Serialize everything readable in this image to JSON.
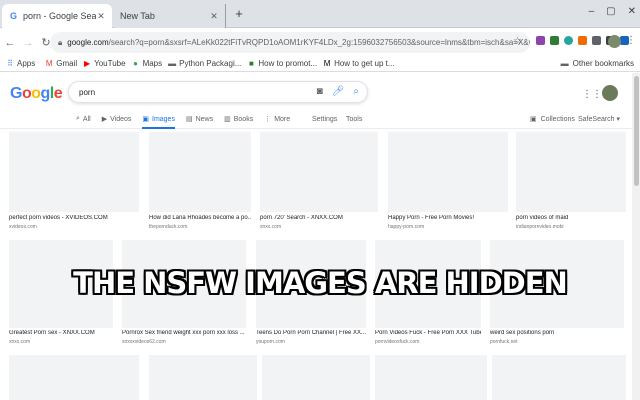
{
  "browser": {
    "tabs": [
      {
        "title": "porn - Google Search",
        "favicon": "G",
        "active": true
      },
      {
        "title": "New Tab",
        "active": false
      }
    ],
    "new_tab_symbol": "+",
    "window_controls": [
      "–",
      "▢",
      "✕"
    ],
    "url_host": "google.com",
    "url_rest": "/search?q=porn&sxsrf=ALeKk022tFiTvRQPD1oAOM1rKYF4LDx_2g:1596032756503&source=lnms&tbm=isch&sa=X&ved=2ahUKEwj43o...",
    "bookmarks": [
      {
        "label": "Apps",
        "icon": "apps-grid-icon",
        "color": "#4285f4"
      },
      {
        "label": "Gmail",
        "icon": "gmail-icon",
        "color": "#ea4335"
      },
      {
        "label": "YouTube",
        "icon": "youtube-icon",
        "color": "#ff0000"
      },
      {
        "label": "Maps",
        "icon": "maps-pin-icon",
        "color": "#34a853"
      },
      {
        "label": "Python Packagi...",
        "icon": "folder-icon",
        "color": "#5f6368"
      },
      {
        "label": "How to promot...",
        "icon": "bookmark-favicon-icon",
        "color": "#2e7d32"
      },
      {
        "label": "How to get up t...",
        "icon": "medium-icon",
        "color": "#000000"
      }
    ],
    "other_bookmarks": "Other bookmarks"
  },
  "google": {
    "logo": "Google",
    "logo_colors": [
      "#4285f4",
      "#ea4335",
      "#fbbc05",
      "#4285f4",
      "#34a853",
      "#ea4335"
    ],
    "query": "porn",
    "tabs": [
      {
        "label": "All",
        "icon": "search-icon",
        "active": false
      },
      {
        "label": "Videos",
        "icon": "video-icon",
        "active": false
      },
      {
        "label": "Images",
        "icon": "image-icon",
        "active": true
      },
      {
        "label": "News",
        "icon": "news-icon",
        "active": false
      },
      {
        "label": "Books",
        "icon": "book-icon",
        "active": false
      },
      {
        "label": "More",
        "icon": "more-dots-icon",
        "active": false
      }
    ],
    "settings": "Settings",
    "tools": "Tools",
    "collections": "Collections",
    "safesearch": "SafeSearch ▾"
  },
  "results": [
    {
      "caption": "perfect porn videos - XVIDEOS.COM",
      "source": "xvideos.com"
    },
    {
      "caption": "How did Lana Rhoades become a po...",
      "source": "thepornduck.com"
    },
    {
      "caption": "porn 720' Search - XNXX.COM",
      "source": "xnxx.com"
    },
    {
      "caption": "Happy Porn - Free Porn Movies!",
      "source": "happy-porn.com"
    },
    {
      "caption": "porn videos of maid",
      "source": "indianpornvideo.mobi"
    },
    {
      "caption": "Greatest Porn sex - XNXX.COM",
      "source": "xnxx.com"
    },
    {
      "caption": "Pornrox Sex friend weight xxx porn xxx loss ...",
      "source": "xnxxxvideos62.com"
    },
    {
      "caption": "Teens Do Porn Porn Channel | Free XX...",
      "source": "youporn.com"
    },
    {
      "caption": "Porn Videos Fuck - Free Porn XXX Tube",
      "source": "pornvideosfuck.com"
    },
    {
      "caption": "weird sex positions porn",
      "source": "pornfuck.net"
    }
  ],
  "overlay_text": "THE NSFW IMAGES ARE HIDDEN"
}
